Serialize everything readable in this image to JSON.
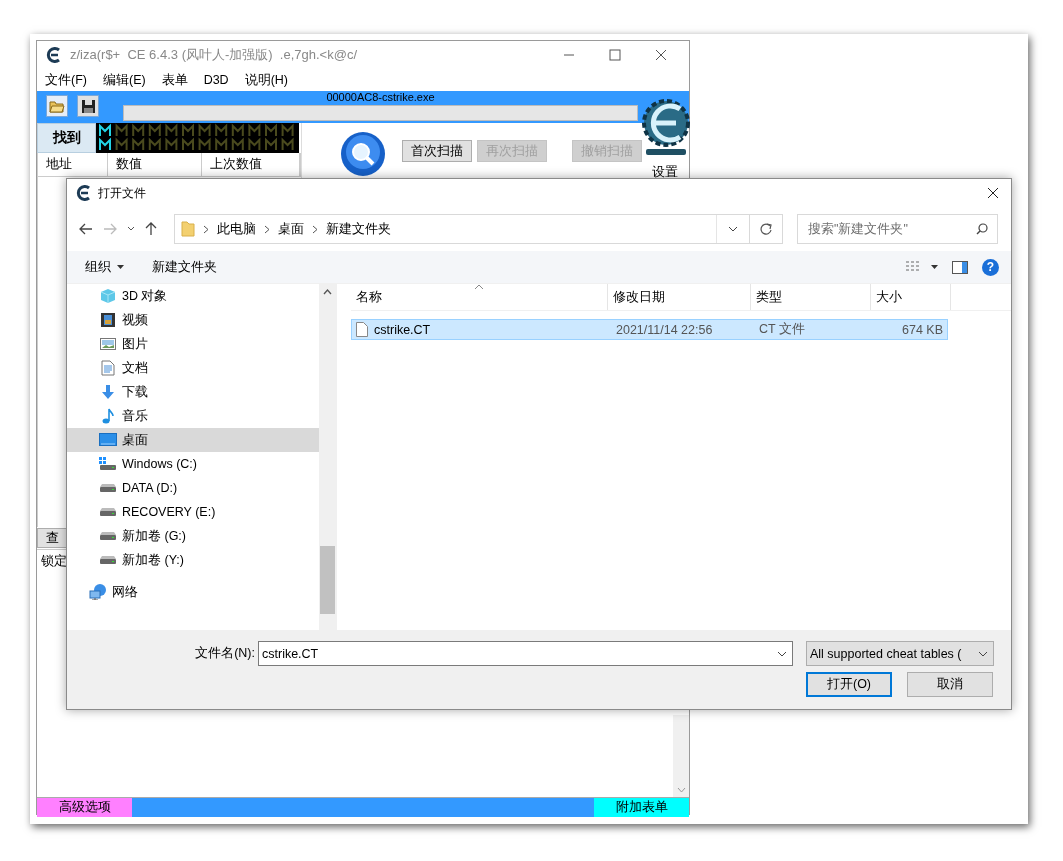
{
  "ce_window": {
    "title": "z/iza(r$+  CE 6.4.3 (风叶人-加强版)  .e,7gh.<k@c/",
    "menu": [
      "文件(F)",
      "编辑(E)",
      "表单",
      "D3D",
      "说明(H)"
    ],
    "process": "00000AC8-cstrike.exe",
    "scan_progress": {
      "level": 0
    },
    "found_label": "找到",
    "scan_buttons": [
      {
        "label": "首次扫描",
        "disabled": false
      },
      {
        "label": "再次扫描",
        "disabled": true
      },
      {
        "label": "撤销扫描",
        "disabled": true
      }
    ],
    "settings_label": "设置",
    "columns": [
      "地址",
      "数值",
      "上次数值"
    ],
    "query_button": "查",
    "lock_column": "锁定",
    "bottom_bar": [
      {
        "label": "高级选项",
        "color": "#ff80ff"
      },
      {
        "label": "附加表单",
        "color": "#00ffff"
      }
    ]
  },
  "dialog": {
    "title": "打开文件",
    "path": [
      "此电脑",
      "桌面",
      "新建文件夹"
    ],
    "search": {
      "placeholder": "搜索\"新建文件夹\""
    },
    "toolbar": [
      {
        "label": "组织",
        "dropdown": true
      },
      {
        "label": "新建文件夹",
        "dropdown": false
      }
    ],
    "help": "?",
    "nav_tree": [
      {
        "label": "3D 对象",
        "selected": false
      },
      {
        "label": "视频",
        "selected": false
      },
      {
        "label": "图片",
        "selected": false
      },
      {
        "label": "文档",
        "selected": false
      },
      {
        "label": "下载",
        "selected": false
      },
      {
        "label": "音乐",
        "selected": false
      },
      {
        "label": "桌面",
        "selected": true
      },
      {
        "label": "Windows (C:)",
        "selected": false
      },
      {
        "label": "DATA (D:)",
        "selected": false
      },
      {
        "label": "RECOVERY (E:)",
        "selected": false
      },
      {
        "label": "新加卷 (G:)",
        "selected": false
      },
      {
        "label": "新加卷 (Y:)",
        "selected": false
      }
    ],
    "nav_root": [
      {
        "label": "网络",
        "selected": false
      }
    ],
    "columns": [
      "名称",
      "修改日期",
      "类型",
      "大小"
    ],
    "files": [
      {
        "name": "cstrike.CT",
        "modified": "2021/11/14 22:56",
        "type": "CT 文件",
        "size": "674 KB",
        "selected": true
      }
    ],
    "filename_label": "文件名(N):",
    "filename": "cstrike.CT",
    "filter": "All supported cheat tables (",
    "buttons": [
      {
        "label": "打开(O)",
        "default": true
      },
      {
        "label": "取消",
        "default": false
      }
    ]
  }
}
